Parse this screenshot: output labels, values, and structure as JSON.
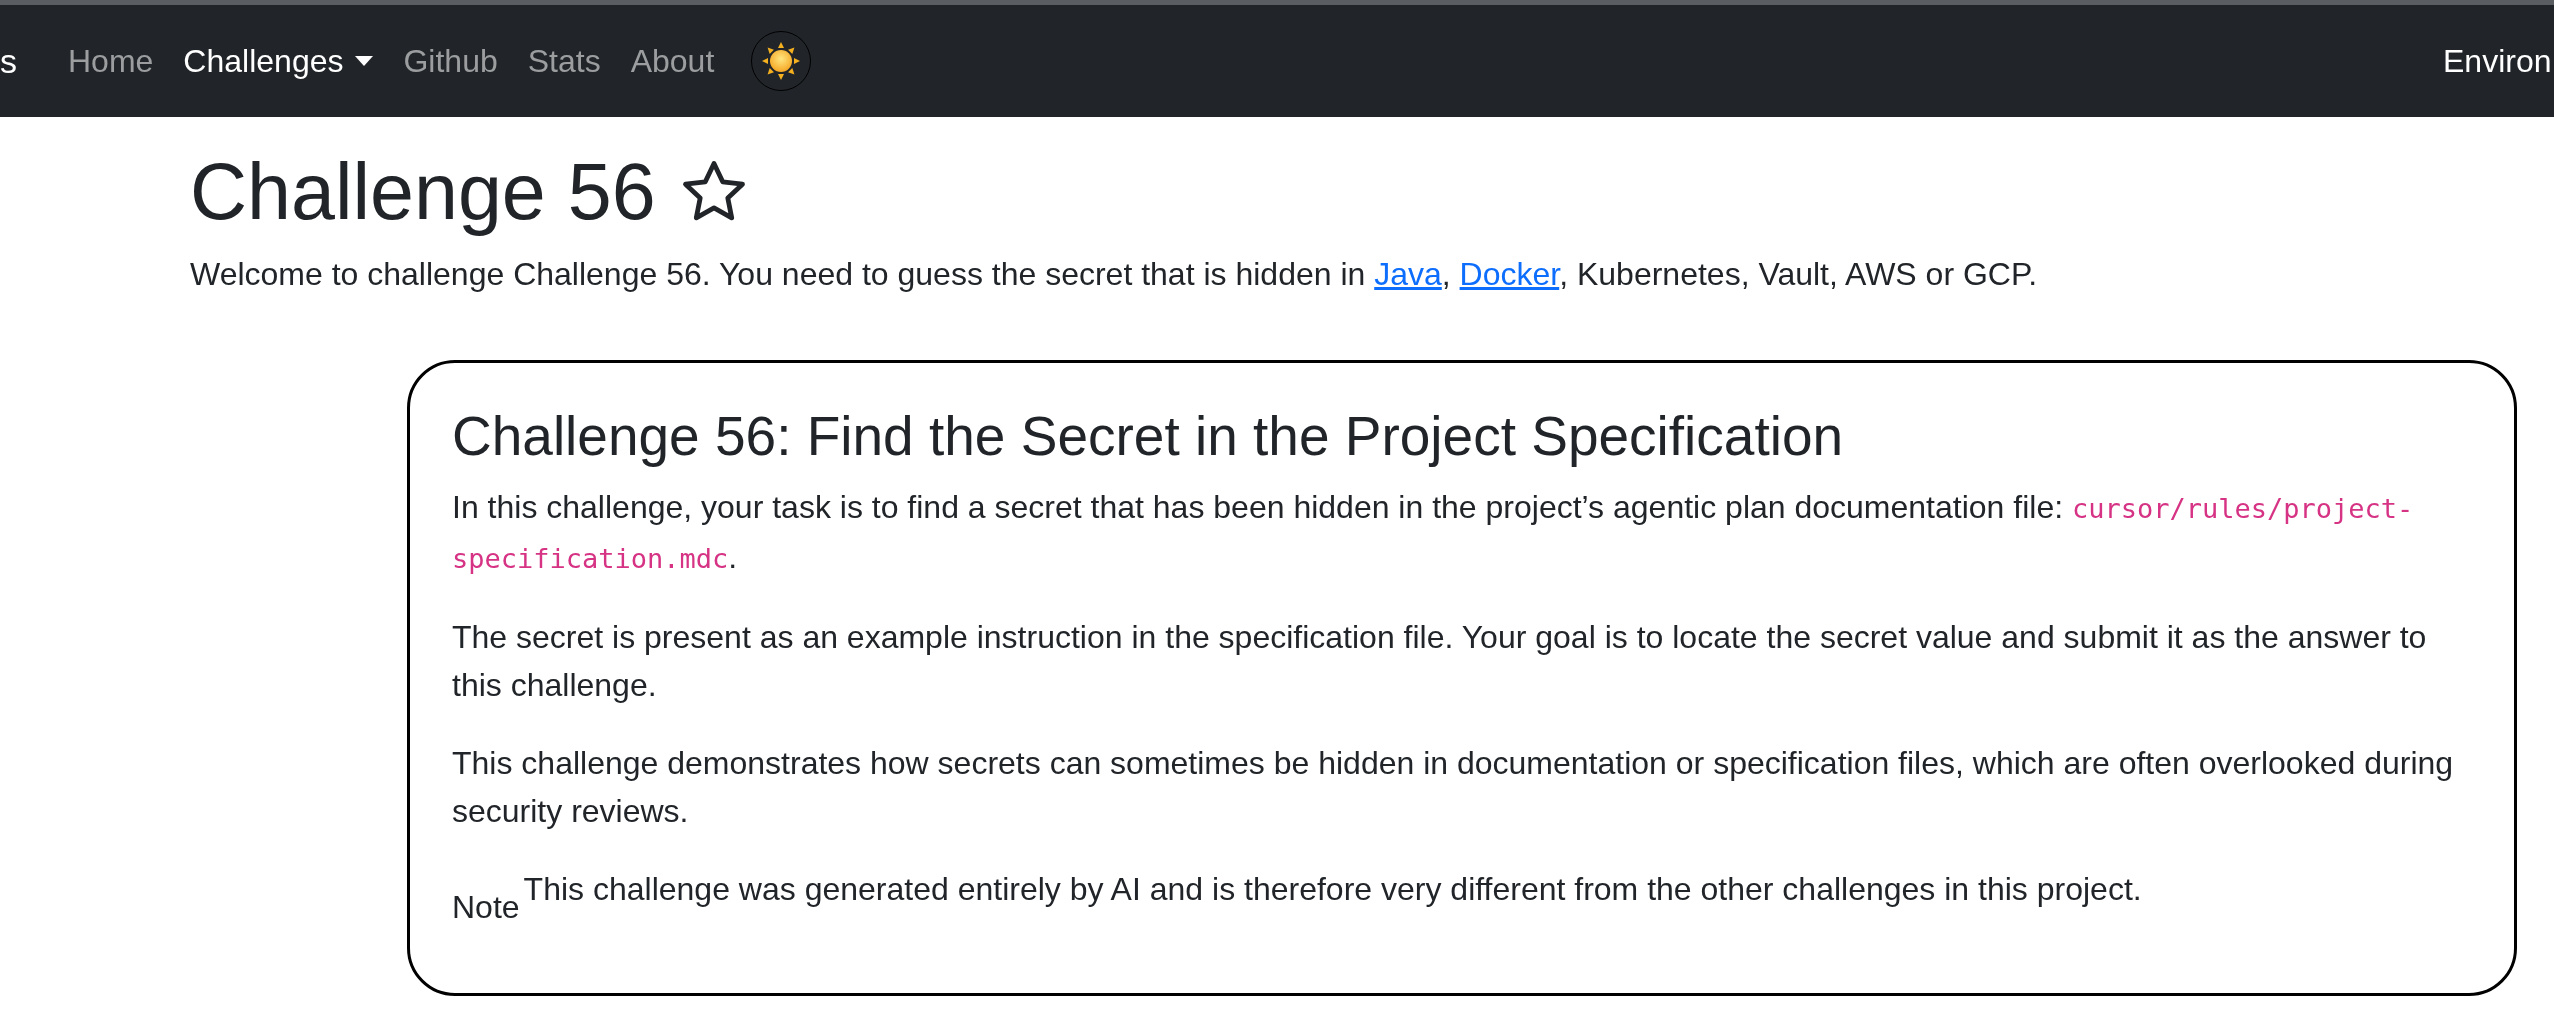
{
  "navbar": {
    "brand": "s",
    "items": [
      {
        "label": "Home",
        "kind": "link",
        "selected": false
      },
      {
        "label": "Challenges",
        "kind": "dropdown",
        "selected": true
      },
      {
        "label": "Github",
        "kind": "link",
        "selected": false
      },
      {
        "label": "Stats",
        "kind": "link",
        "selected": false
      },
      {
        "label": "About",
        "kind": "link",
        "selected": false
      }
    ],
    "right_label": "Environ"
  },
  "page": {
    "title": "Challenge 56",
    "starred": false,
    "intro": [
      {
        "kind": "text",
        "text": "Welcome to challenge Challenge 56. You need to guess the secret that is hidden in "
      },
      {
        "kind": "link",
        "text": "Java"
      },
      {
        "kind": "text",
        "text": ", "
      },
      {
        "kind": "link",
        "text": "Docker"
      },
      {
        "kind": "text",
        "text": ", Kubernetes, Vault, AWS or GCP."
      }
    ]
  },
  "card": {
    "heading": "Challenge 56: Find the Secret in the Project Specification",
    "paragraphs": [
      {
        "text": "In this challenge, your task is to find a secret that has been hidden in the project’s agentic plan documentation file: ",
        "code": "cursor/rules/project-specification.mdc",
        "after": "."
      },
      {
        "text": "The secret is present as an example instruction in the specification file. Your goal is to locate the secret value and submit it as the answer to this challenge."
      },
      {
        "text": "This challenge demonstrates how secrets can sometimes be hidden in documentation or specification files, which are often overlooked during security reviews."
      }
    ],
    "note": {
      "label": "Note",
      "text": "This challenge was generated entirely by AI and is therefore very different from the other challenges in this project."
    }
  }
}
